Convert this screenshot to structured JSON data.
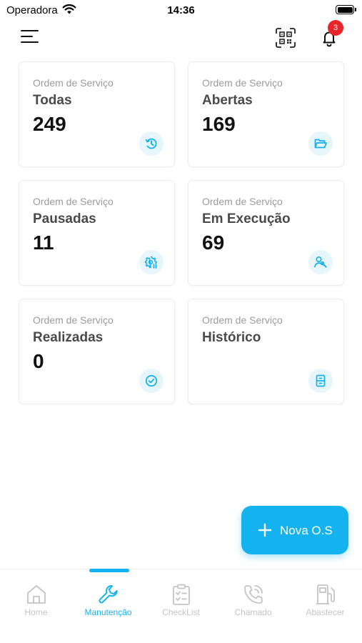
{
  "status_bar": {
    "carrier": "Operadora",
    "time": "14:36",
    "battery_level": 1.0
  },
  "header": {
    "notification_count": "3"
  },
  "cards": [
    {
      "subtitle": "Ordem de Serviço",
      "title": "Todas",
      "count": "249",
      "icon": "clock-history-icon"
    },
    {
      "subtitle": "Ordem de Serviço",
      "title": "Abertas",
      "count": "169",
      "icon": "folder-open-icon"
    },
    {
      "subtitle": "Ordem de Serviço",
      "title": "Pausadas",
      "count": "11",
      "icon": "gear-pause-icon"
    },
    {
      "subtitle": "Ordem de Serviço",
      "title": "Em Execução",
      "count": "69",
      "icon": "user-wrench-icon"
    },
    {
      "subtitle": "Ordem de Serviço",
      "title": "Realizadas",
      "count": "0",
      "icon": "check-circle-icon"
    },
    {
      "subtitle": "Ordem de Serviço",
      "title": "Histórico",
      "count": "",
      "icon": "archive-icon"
    }
  ],
  "fab": {
    "label": "Nova O.S",
    "icon": "plus-icon"
  },
  "bottom_nav": [
    {
      "label": "Home",
      "icon": "home-icon",
      "active": false
    },
    {
      "label": "Manutenção",
      "icon": "wrench-icon",
      "active": true
    },
    {
      "label": "CheckList",
      "icon": "clipboard-check-icon",
      "active": false
    },
    {
      "label": "Chamado",
      "icon": "phone-call-icon",
      "active": false
    },
    {
      "label": "Abastecer",
      "icon": "fuel-pump-icon",
      "active": false
    }
  ],
  "colors": {
    "accent": "#14b3ef",
    "badge": "#e8262a",
    "icon_bg": "#e7f5fc",
    "inactive": "#c4c4c4"
  }
}
